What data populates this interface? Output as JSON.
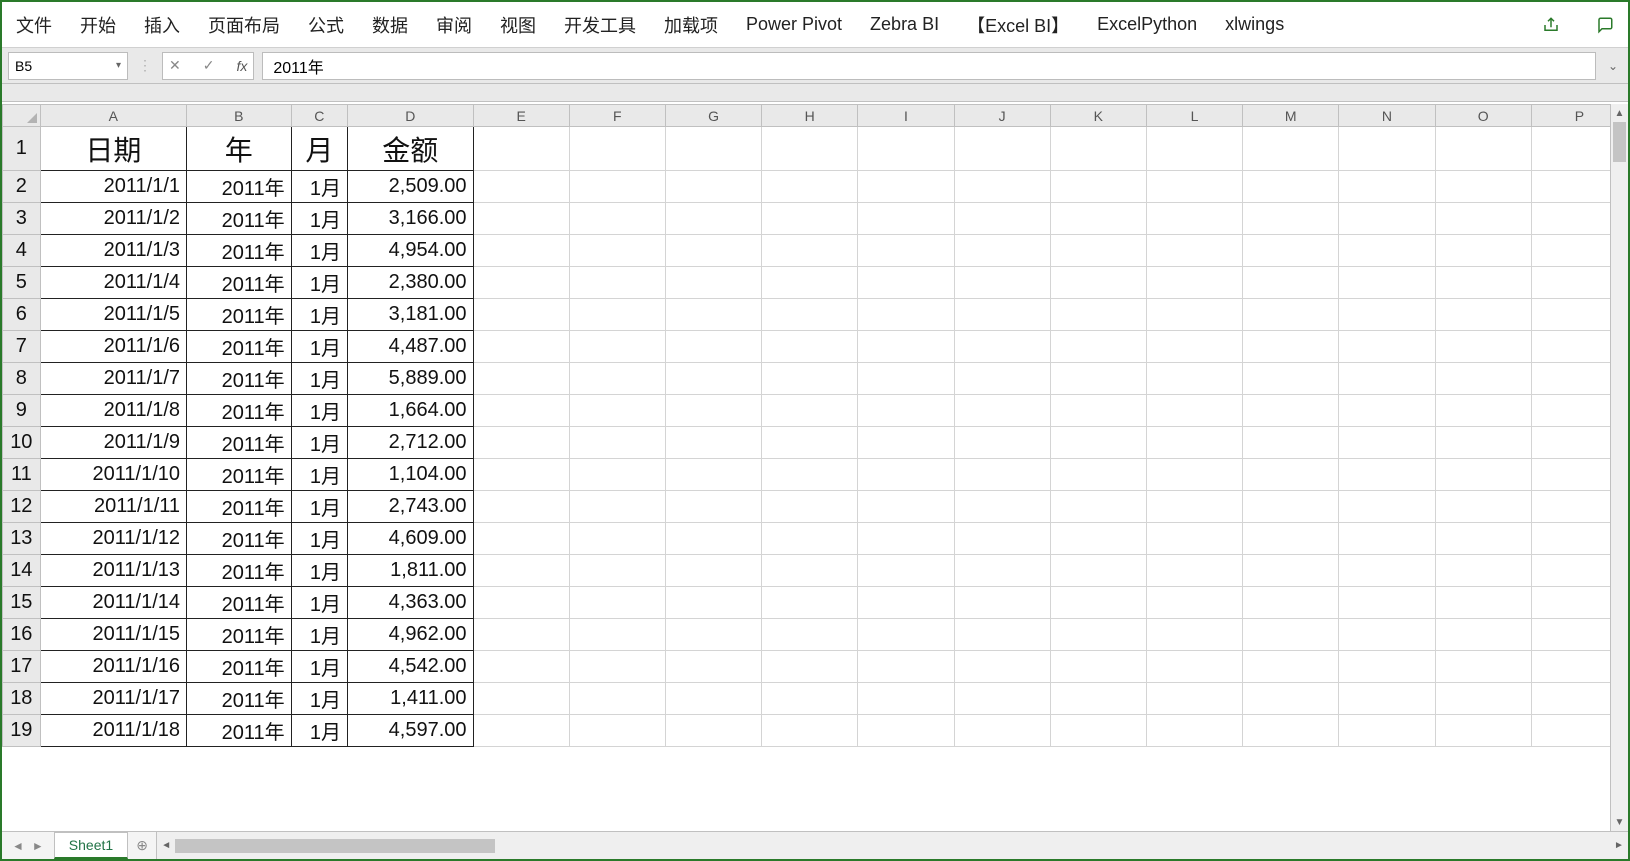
{
  "ribbon": {
    "items": [
      "文件",
      "开始",
      "插入",
      "页面布局",
      "公式",
      "数据",
      "审阅",
      "视图",
      "开发工具",
      "加载项",
      "Power Pivot",
      "Zebra BI",
      "【Excel BI】",
      "ExcelPython",
      "xlwings"
    ]
  },
  "namebox": {
    "value": "B5"
  },
  "formula": {
    "value": "2011年"
  },
  "columns": [
    "A",
    "B",
    "C",
    "D",
    "E",
    "F",
    "G",
    "H",
    "I",
    "J",
    "K",
    "L",
    "M",
    "N",
    "O",
    "P"
  ],
  "rowcount": 19,
  "headers": {
    "A": "日期",
    "B": "年",
    "C": "月",
    "D": "金额"
  },
  "rows": [
    {
      "date": "2011/1/1",
      "year": "2011年",
      "month": "1月",
      "amount": "2,509.00"
    },
    {
      "date": "2011/1/2",
      "year": "2011年",
      "month": "1月",
      "amount": "3,166.00"
    },
    {
      "date": "2011/1/3",
      "year": "2011年",
      "month": "1月",
      "amount": "4,954.00"
    },
    {
      "date": "2011/1/4",
      "year": "2011年",
      "month": "1月",
      "amount": "2,380.00"
    },
    {
      "date": "2011/1/5",
      "year": "2011年",
      "month": "1月",
      "amount": "3,181.00"
    },
    {
      "date": "2011/1/6",
      "year": "2011年",
      "month": "1月",
      "amount": "4,487.00"
    },
    {
      "date": "2011/1/7",
      "year": "2011年",
      "month": "1月",
      "amount": "5,889.00"
    },
    {
      "date": "2011/1/8",
      "year": "2011年",
      "month": "1月",
      "amount": "1,664.00"
    },
    {
      "date": "2011/1/9",
      "year": "2011年",
      "month": "1月",
      "amount": "2,712.00"
    },
    {
      "date": "2011/1/10",
      "year": "2011年",
      "month": "1月",
      "amount": "1,104.00"
    },
    {
      "date": "2011/1/11",
      "year": "2011年",
      "month": "1月",
      "amount": "2,743.00"
    },
    {
      "date": "2011/1/12",
      "year": "2011年",
      "month": "1月",
      "amount": "4,609.00"
    },
    {
      "date": "2011/1/13",
      "year": "2011年",
      "month": "1月",
      "amount": "1,811.00"
    },
    {
      "date": "2011/1/14",
      "year": "2011年",
      "month": "1月",
      "amount": "4,363.00"
    },
    {
      "date": "2011/1/15",
      "year": "2011年",
      "month": "1月",
      "amount": "4,962.00"
    },
    {
      "date": "2011/1/16",
      "year": "2011年",
      "month": "1月",
      "amount": "4,542.00"
    },
    {
      "date": "2011/1/17",
      "year": "2011年",
      "month": "1月",
      "amount": "1,411.00"
    },
    {
      "date": "2011/1/18",
      "year": "2011年",
      "month": "1月",
      "amount": "4,597.00"
    }
  ],
  "sheet": {
    "name": "Sheet1"
  }
}
